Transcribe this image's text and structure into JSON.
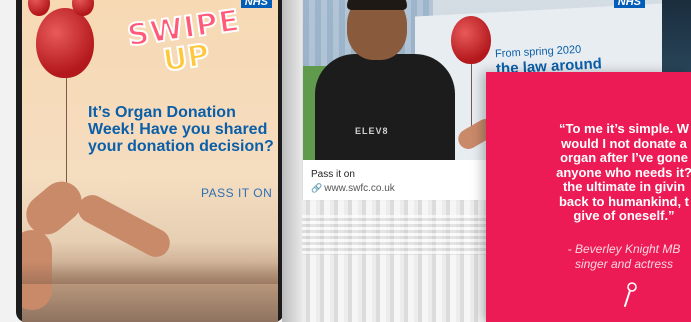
{
  "story_card": {
    "brand_logo": "NHS",
    "swipe_line1": "SWIPE",
    "swipe_line2": "UP",
    "headline": "It’s Organ Donation Week! Have you shared your donation decision?",
    "cta": "PASS IT ON"
  },
  "social_card": {
    "poster_logo": "NHS",
    "shirt_text": "ELEV8",
    "poster_line1": "From spring 2020",
    "poster_line2": "the law around",
    "link_title": "Pass it on",
    "link_url": "www.swfc.co.uk"
  },
  "quote_card": {
    "quote": "“To me it’s simple. W\nwould I not donate a\norgan after I’ve gone\nanyone who needs it?\nthe ultimate in givin\nback to humankind, t\ngive of oneself.”",
    "author": "- Beverley Knight MB\nsinger and actress",
    "background": "#ec1b55"
  },
  "icons": [
    "balloon-icon",
    "link-icon",
    "microphone-icon"
  ]
}
